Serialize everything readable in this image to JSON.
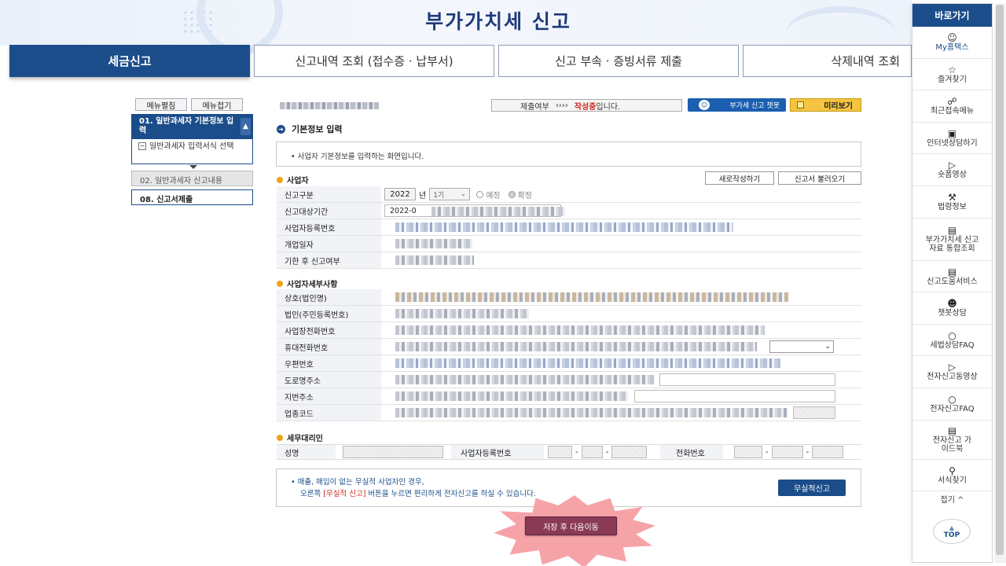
{
  "page_title": "부가가치세 신고",
  "tabs": [
    "세금신고",
    "신고내역 조회 (접수증 · 납부서)",
    "신고 부속 · 증빙서류 제출",
    "삭제내역 조회"
  ],
  "left_menu": {
    "expand_label": "메뉴펼침",
    "collapse_label": "메뉴접기",
    "step1": "01. 일반과세자 기본정보 입력",
    "step1_sub": "일반과세자 입력서식 선택",
    "step2": "02. 일반과세자 신고내용",
    "step3": "08. 신고서제출"
  },
  "status": {
    "label": "제출여부",
    "arrows": "››››",
    "state": "작성중",
    "suffix": "입니다."
  },
  "chatbot_label": "부가세 신고 챗봇",
  "preview_label": "미리보기",
  "section_title": "기본정보 입력",
  "info_text": "• 사업자 기본정보를 입력하는 화면입니다.",
  "business_section": "사업자",
  "new_write_button": "새로작성하기",
  "load_report_button": "신고서 불러오기",
  "form": {
    "report_type_label": "신고구분",
    "year": "2022",
    "year_unit": "년",
    "period": "1기",
    "radio_planned": "예정",
    "radio_final": "확정",
    "report_period_label": "신고대상기간",
    "report_period_value": "2022-0",
    "biz_no_label": "사업자등록번호",
    "open_date_label": "개업일자",
    "late_label": "기한 후 신고여부"
  },
  "details_section": "사업자세부사항",
  "details": {
    "company_name": "상호(법인명)",
    "corp_no": "법인(주민등록번호)",
    "office_phone": "사업장전화번호",
    "mobile": "휴대전화번호",
    "postal": "우편번호",
    "road_address": "도로명주소",
    "lot_address": "지번주소",
    "industry_code": "업종코드"
  },
  "agent_section": "세무대리인",
  "agent": {
    "name_label": "성명",
    "biz_no_label": "사업자등록번호",
    "phone_label": "전화번호",
    "dash": "-"
  },
  "notice": {
    "line1": "• 매출, 매입이 없는 무실적 사업자인 경우,",
    "line2_pre": "오른쪽",
    "line2_highlight": "[무실적 신고]",
    "line2_post": "버튼을 누르면 편리하게 전자신고를 하실 수 있습니다."
  },
  "nil_report_button": "무실적신고",
  "save_next_button": "저장 후 다음이동",
  "quick_menu": {
    "title": "바로가기",
    "items": [
      {
        "label": "My홈택스",
        "icon": "person-icon"
      },
      {
        "label": "즐겨찾기",
        "icon": "star-icon"
      },
      {
        "label": "최근접속메뉴",
        "icon": "recent-icon"
      },
      {
        "label": "인터넷상담하기",
        "icon": "laptop-icon"
      },
      {
        "label": "숏폼영상",
        "icon": "play-icon"
      },
      {
        "label": "법령정보",
        "icon": "gavel-icon"
      },
      {
        "label": "부가가치세 신고자료 통합조회",
        "icon": "book-icon"
      },
      {
        "label": "신고도움서비스",
        "icon": "book-icon"
      },
      {
        "label": "챗봇상담",
        "icon": "chatbot-icon"
      },
      {
        "label": "세법상담FAQ",
        "icon": "chat-icon"
      },
      {
        "label": "전자신고동영상",
        "icon": "play-icon"
      },
      {
        "label": "전자신고FAQ",
        "icon": "chat-icon"
      },
      {
        "label": "전자신고 가이드북",
        "icon": "book-icon"
      },
      {
        "label": "서식찾기",
        "icon": "search-icon"
      }
    ],
    "fold_label": "접기 ^",
    "top_label": "TOP"
  },
  "colors": {
    "primary": "#1b4d8a",
    "accent_red": "#d0261f",
    "preview_yellow": "#f5c542",
    "save_button": "#8a3a55"
  }
}
